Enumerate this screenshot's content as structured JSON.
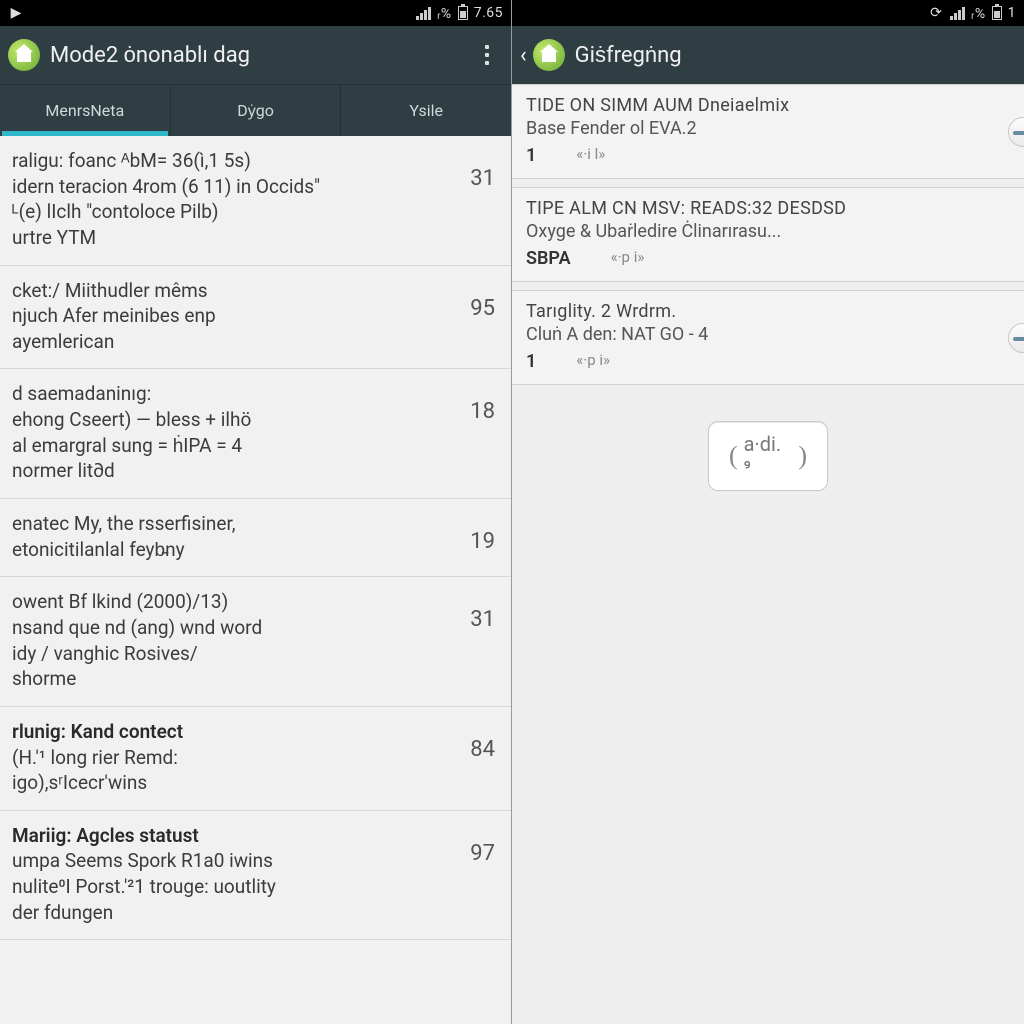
{
  "left": {
    "status": {
      "pct": "ᵣ%",
      "time": "7.65"
    },
    "title": "Mode2 ȯnonablı dag",
    "tabs": [
      {
        "label": "MenrsNeta",
        "active": true
      },
      {
        "label": "Dẏgo",
        "active": false
      },
      {
        "label": "Ysile",
        "active": false
      }
    ],
    "items": [
      {
        "lines": [
          "raligu: foanc ᴬbM= 36(ì,1 5s)",
          "idern teracion 4rom (6 11) in Occids\"",
          "ᴸ(e) lIclh \"contoloce Pilb)",
          "urtre YTM"
        ],
        "count": "31",
        "bold_index": -1
      },
      {
        "lines": [
          "cket:/ Miithudler mêms",
          "njuch Afer meinibes enp",
          "ayemlerican"
        ],
        "count": "95",
        "bold_index": -1
      },
      {
        "lines": [
          "d saemadaninıg:",
          "ehong Cseert) — bless + ilhö",
          "al emargral sung = ḣIPA = 4",
          "normer lit∂d"
        ],
        "count": "18",
        "bold_index": -1
      },
      {
        "lines": [
          "enatec My, the rsserfisiner,",
          "etonicitilanlal feyb̵ny"
        ],
        "count": "19",
        "bold_index": -1
      },
      {
        "lines": [
          "owent Bf lkind (2000)/13)",
          "nsand que nd (ang) wnd word",
          "idy / vanghic Rosives/",
          "shorme"
        ],
        "count": "31",
        "bold_index": -1
      },
      {
        "lines": [
          "rlunig: Kand contect",
          "(H.'¹ long rier Remd:",
          "igo),sʳIcecr'wins"
        ],
        "count": "84",
        "bold_index": 0
      },
      {
        "lines": [
          "Mariig: Agcles statust",
          "umpa Seems Spork R1a0 iwins",
          "nulite⁰I Porst.'²1 trouge: uoutlity",
          "der fdungen"
        ],
        "count": "97",
        "bold_index": 0
      }
    ]
  },
  "right": {
    "status": {
      "pct": "ᵣ%",
      "time": "1"
    },
    "title": "Giṡfregṅng",
    "cards": [
      {
        "h": "TIDE ON SIMM AUM Dneiaelmix",
        "sub": "Base Fender ol EVA.2",
        "tag": "1",
        "meta": "«·i l»",
        "pill": true
      },
      {
        "h": "TIPE ALM CN MSV: READS:32 DESDSD",
        "sub": "Oxyge & Ubaṙledire Ċlinarırasu...",
        "tag": "SBPA",
        "meta": "«·p i»",
        "pill": false
      },
      {
        "h": "Tarıglity. 2 Wrdrm.",
        "sub": "Cluṅ A den: NAT GO - 4",
        "tag": "1",
        "meta": "«·p i»",
        "pill": true
      }
    ],
    "footer": "a·di. ⁹"
  }
}
